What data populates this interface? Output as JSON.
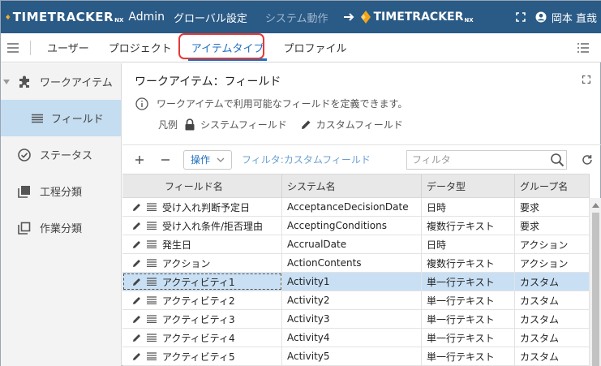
{
  "header": {
    "brand_text": "TIMETRACKER",
    "brand_suffix": "NX",
    "admin_label": "Admin",
    "nav": [
      {
        "label": "グローバル設定",
        "active": true
      },
      {
        "label": "システム動作",
        "active": false
      }
    ],
    "brand2_text": "TIMETRACKER",
    "brand2_suffix": "NX",
    "user_name": "岡本 直哉"
  },
  "subnav": {
    "tabs": [
      {
        "label": "ユーザー",
        "active": false
      },
      {
        "label": "プロジェクト",
        "active": false
      },
      {
        "label": "アイテムタイプ",
        "active": true
      },
      {
        "label": "プロファイル",
        "active": false
      }
    ]
  },
  "sidebar": {
    "items": [
      {
        "label": "ワークアイテム",
        "icon": "puzzle-icon",
        "expanded": true
      },
      {
        "label": "フィールド",
        "icon": "list-icon",
        "selected": true
      },
      {
        "label": "ステータス",
        "icon": "check-circle-icon"
      },
      {
        "label": "工程分類",
        "icon": "stack-filled-icon"
      },
      {
        "label": "作業分類",
        "icon": "stack-outline-icon"
      }
    ]
  },
  "main": {
    "title": "ワークアイテム：フィールド",
    "info": "ワークアイテムで利用可能なフィールドを定義できます。",
    "legend_label": "凡例",
    "legend_system": "システムフィールド",
    "legend_custom": "カスタムフィールド"
  },
  "toolbar": {
    "ops_label": "操作",
    "filter_label": "フィルタ:カスタムフィールド",
    "filter_placeholder": "フィルタ"
  },
  "grid": {
    "columns": [
      "フィールド名",
      "システム名",
      "データ型",
      "グループ名"
    ],
    "rows": [
      {
        "name": "受け入れ判断予定日",
        "system": "AcceptanceDecisionDate",
        "type": "日時",
        "group": "要求"
      },
      {
        "name": "受け入れ条件/拒否理由",
        "system": "AcceptingConditions",
        "type": "複数行テキスト",
        "group": "要求"
      },
      {
        "name": "発生日",
        "system": "AccrualDate",
        "type": "日時",
        "group": "アクション"
      },
      {
        "name": "アクション",
        "system": "ActionContents",
        "type": "複数行テキスト",
        "group": "アクション"
      },
      {
        "name": "アクティビティ1",
        "system": "Activity1",
        "type": "単一行テキスト",
        "group": "カスタム",
        "selected": true
      },
      {
        "name": "アクティビティ2",
        "system": "Activity2",
        "type": "単一行テキスト",
        "group": "カスタム"
      },
      {
        "name": "アクティビティ3",
        "system": "Activity3",
        "type": "単一行テキスト",
        "group": "カスタム"
      },
      {
        "name": "アクティビティ4",
        "system": "Activity4",
        "type": "単一行テキスト",
        "group": "カスタム"
      },
      {
        "name": "アクティビティ5",
        "system": "Activity5",
        "type": "単一行テキスト",
        "group": "カスタム"
      }
    ]
  },
  "colors": {
    "topbar": "#2a5a86",
    "accent": "#1f6fc0",
    "highlight": "#e53935",
    "selected_row": "#c9e0f4",
    "sidebar_selected": "#c4ddf1"
  }
}
